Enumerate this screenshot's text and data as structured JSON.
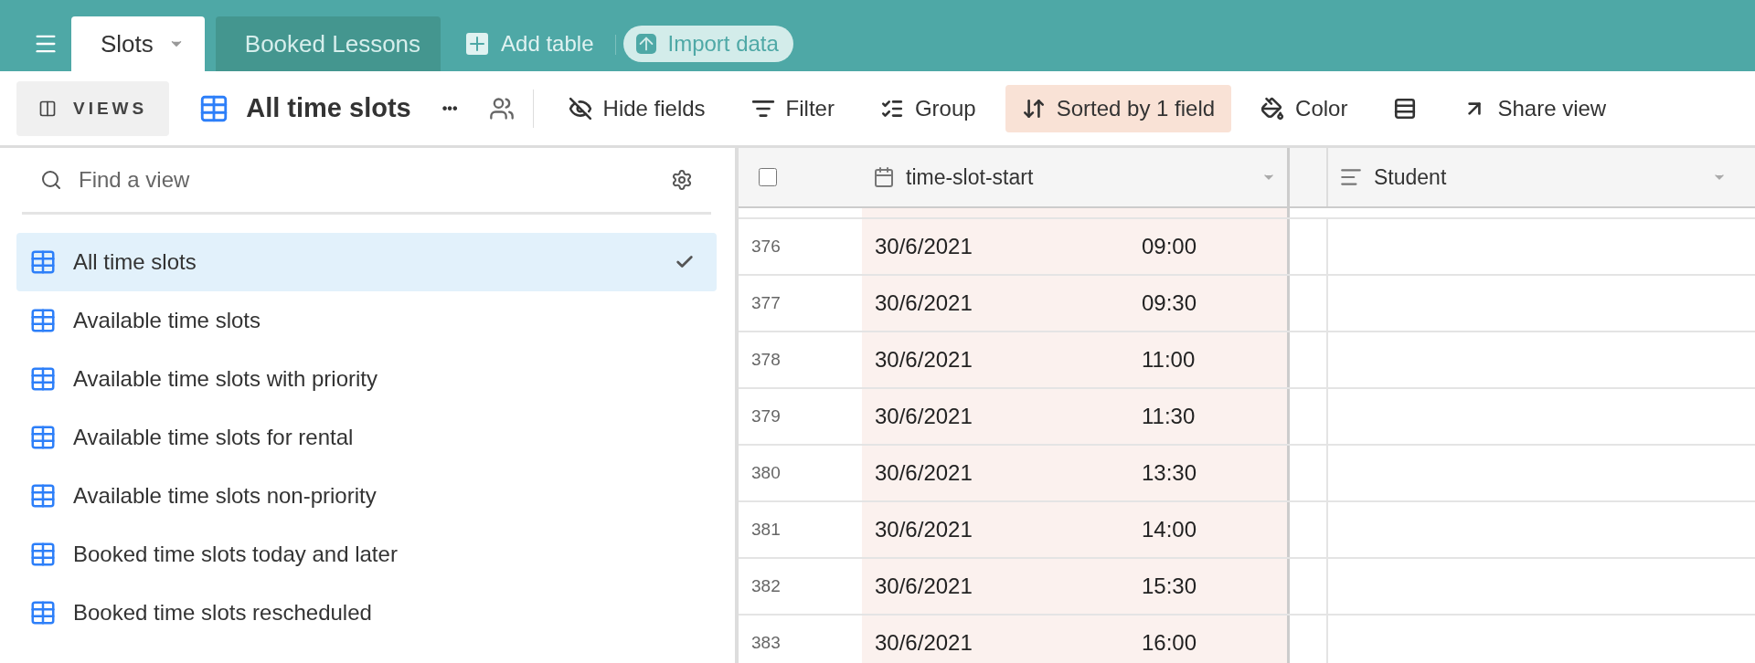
{
  "tables": [
    {
      "label": "Slots",
      "selected": true
    },
    {
      "label": "Booked Lessons",
      "selected": false
    }
  ],
  "add_table": "Add table",
  "import_data": "Import data",
  "toolbar": {
    "views_button": "VIEWS",
    "view_name": "All time slots",
    "more": "•••",
    "actions": [
      {
        "kind": "hide",
        "label": "Hide fields",
        "active": false
      },
      {
        "kind": "filter",
        "label": "Filter",
        "active": false
      },
      {
        "kind": "group",
        "label": "Group",
        "active": false
      },
      {
        "kind": "sort",
        "label": "Sorted by 1 field",
        "active": true
      },
      {
        "kind": "color",
        "label": "Color",
        "active": false
      },
      {
        "kind": "height",
        "active": false
      },
      {
        "kind": "share",
        "label": "Share view",
        "active": false
      }
    ]
  },
  "sidebar": {
    "search": {
      "placeholder": "Find a view"
    },
    "views": [
      {
        "label": "All time slots",
        "selected": true
      },
      {
        "label": "Available time slots",
        "selected": false
      },
      {
        "label": "Available time slots with priority",
        "selected": false
      },
      {
        "label": "Available time slots for rental",
        "selected": false
      },
      {
        "label": "Available time slots non-priority",
        "selected": false
      },
      {
        "label": "Booked time slots today and later",
        "selected": false
      },
      {
        "label": "Booked time slots rescheduled",
        "selected": false
      }
    ]
  },
  "table": {
    "select_all": {
      "checked": false
    },
    "columns": [
      {
        "kind": "date",
        "label": "time-slot-start"
      },
      {
        "kind": "link",
        "label": "Student"
      }
    ],
    "rows": [
      {
        "number": "376",
        "date": "30/6/2021",
        "time": "09:00"
      },
      {
        "number": "377",
        "date": "30/6/2021",
        "time": "09:30"
      },
      {
        "number": "378",
        "date": "30/6/2021",
        "time": "11:00"
      },
      {
        "number": "379",
        "date": "30/6/2021",
        "time": "11:30"
      },
      {
        "number": "380",
        "date": "30/6/2021",
        "time": "13:30"
      },
      {
        "number": "381",
        "date": "30/6/2021",
        "time": "14:00"
      },
      {
        "number": "382",
        "date": "30/6/2021",
        "time": "15:30"
      },
      {
        "number": "383",
        "date": "30/6/2021",
        "time": "16:00"
      }
    ]
  }
}
